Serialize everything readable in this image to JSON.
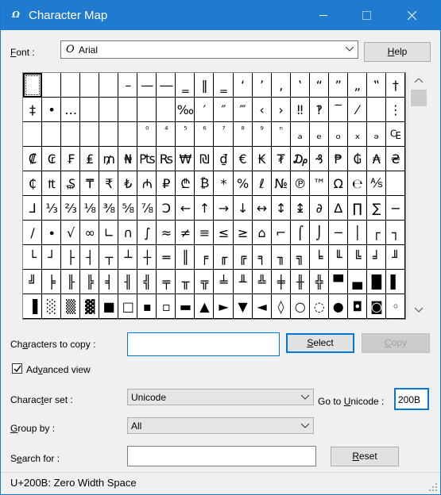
{
  "window": {
    "title": "Character Map"
  },
  "font": {
    "label_prefix": "F",
    "label_rest": "ont :",
    "glyph": "O",
    "value": "Arial"
  },
  "help_button": {
    "u": "H",
    "rest": "elp"
  },
  "chars": [
    [
      " ",
      "",
      "",
      "",
      "",
      "–",
      "—",
      "―",
      "‗",
      "‖",
      "‗",
      "‘",
      "’",
      "‚",
      "‛",
      "“",
      "”",
      "„",
      "‟",
      "†"
    ],
    [
      "‡",
      "•",
      "…",
      "",
      "",
      "",
      "",
      "",
      "‰",
      "′",
      "″",
      "‴",
      "‹",
      "›",
      "‼",
      "‽",
      "‾",
      "⁄",
      "",
      "⋮"
    ],
    [
      "",
      "",
      "",
      "",
      "",
      "",
      "⁰",
      "⁴",
      "⁵",
      "⁶",
      "⁷",
      "⁸",
      "⁹",
      "ⁿ",
      "ₐ",
      "ₑ",
      "ₒ",
      "ₓ",
      "ₔ",
      "₠"
    ],
    [
      "₡",
      "₢",
      "₣",
      "₤",
      "₥",
      "₦",
      "₧",
      "₨",
      "₩",
      "₪",
      "₫",
      "€",
      "₭",
      "₮",
      "₯",
      "₰",
      "₱",
      "₲",
      "₳",
      "₴"
    ],
    [
      "₵",
      "₶",
      "₷",
      "₸",
      "₹",
      "₺",
      "₼",
      "₽",
      "₾",
      "₿",
      "*",
      "%",
      "ℓ",
      "№",
      "℗",
      "™",
      "Ω",
      "℮",
      "⅍",
      ""
    ],
    [
      "⅃",
      "⅓",
      "⅔",
      "⅛",
      "⅜",
      "⅝",
      "⅞",
      "Ↄ",
      "←",
      "↑",
      "→",
      "↓",
      "↔",
      "↕",
      "↨",
      "∂",
      "∆",
      "∏",
      "∑",
      "−"
    ],
    [
      "∕",
      "∙",
      "√",
      "∞",
      "∟",
      "∩",
      "∫",
      "≈",
      "≠",
      "≡",
      "≤",
      "≥",
      "⌂",
      "⌐",
      "⌠",
      "⌡",
      "─",
      "│",
      "┌",
      "┐"
    ],
    [
      "└",
      "┘",
      "├",
      "┤",
      "┬",
      "┴",
      "┼",
      "═",
      "║",
      "╒",
      "╓",
      "╔",
      "╕",
      "╖",
      "╗",
      "╘",
      "╙",
      "╚",
      "╛",
      "╜"
    ],
    [
      "╝",
      "╞",
      "╟",
      "╠",
      "╡",
      "╢",
      "╣",
      "╤",
      "╥",
      "╦",
      "╧",
      "╨",
      "╩",
      "╪",
      "╫",
      "╬",
      "▀",
      "▄",
      "█",
      "▌"
    ],
    [
      "▐",
      "░",
      "▒",
      "▓",
      "■",
      "□",
      "▪",
      "▫",
      "▬",
      "▲",
      "►",
      "▼",
      "◄",
      "◊",
      "○",
      "◌",
      "●",
      "◘",
      "◙",
      "◦"
    ]
  ],
  "copy": {
    "label_pre": "Ch",
    "label_u": "a",
    "label_post": "racters to copy :",
    "value": ""
  },
  "select_button": {
    "pre": "",
    "u": "S",
    "rest": "elect"
  },
  "copy_button": {
    "pre": "",
    "u": "C",
    "rest": "opy"
  },
  "advanced_view": {
    "pre": "Ad",
    "u": "v",
    "rest": "anced view",
    "checked": true
  },
  "charset": {
    "label_pre": "Charac",
    "label_u": "t",
    "label_post": "er set :",
    "value": "Unicode"
  },
  "goto_unicode": {
    "label_pre": "Go to ",
    "label_u": "U",
    "label_post": "nicode :",
    "value": "200B"
  },
  "groupby": {
    "label_pre": "",
    "label_u": "G",
    "label_post": "roup by :",
    "value": "All"
  },
  "search": {
    "label_pre": "S",
    "label_u": "e",
    "label_post": "arch for :",
    "value": ""
  },
  "reset_button": {
    "pre": "",
    "u": "R",
    "rest": "eset"
  },
  "status": {
    "text": "U+200B: Zero Width Space"
  }
}
